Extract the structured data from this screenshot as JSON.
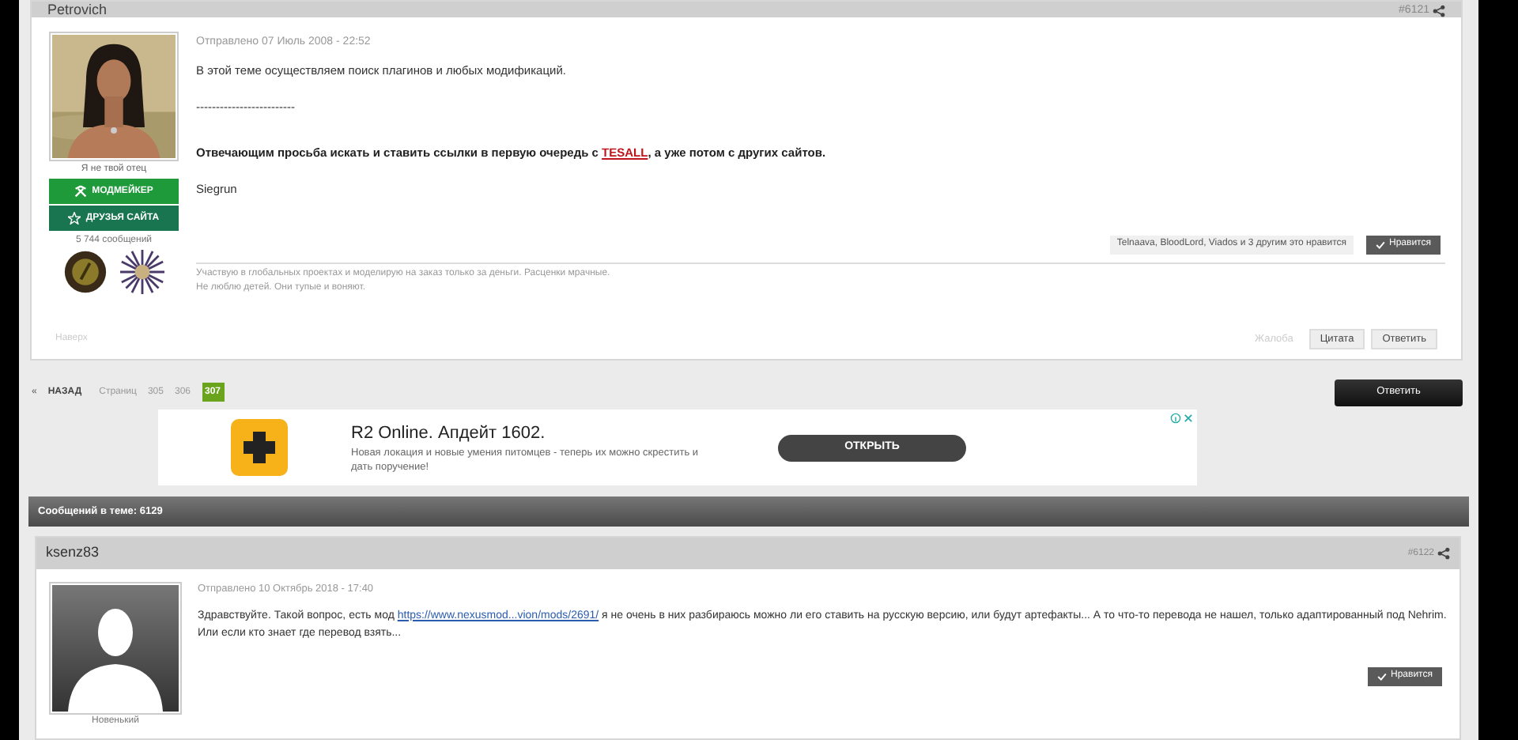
{
  "posts": [
    {
      "author": "Petrovich",
      "number": "#6121",
      "date": "Отправлено 07 Июль 2008 - 22:52",
      "user_title": "Я не твой отец",
      "badges": [
        {
          "label": "МОДМЕЙКЕР",
          "kind": "hammers",
          "color": "#1f9a3b"
        },
        {
          "label": "ДРУЗЬЯ САЙТА",
          "kind": "star",
          "color": "#18754f"
        }
      ],
      "post_count": "5 744 сообщений",
      "medals": true,
      "body": [
        {
          "kind": "text",
          "text": "В этой теме осуществляем поиск плагинов и любых модификаций."
        },
        {
          "kind": "text",
          "text": "-------------------------"
        },
        {
          "kind": "bold_link",
          "before": "Отвечающим просьба искать и ставить ссылки в первую очередь с ",
          "link": "TESALL",
          "after": ", а уже потом с других сайтов."
        },
        {
          "kind": "text",
          "text": "Siegrun"
        }
      ],
      "likes_text": "Telnaava, BloodLord, Viados и 3 другим это нравится",
      "like_button": "Нравится",
      "signature": [
        "Участвую в глобальных проектах и моделирую на заказ только за деньги. Расценки мрачные.",
        "Не люблю детей. Они тупые и воняют."
      ],
      "top_link": "Наверх",
      "actions": [
        {
          "label": "Жалоба",
          "disabled": true
        },
        {
          "label": "Цитата",
          "disabled": false
        },
        {
          "label": "Ответить",
          "disabled": false
        }
      ]
    }
  ],
  "pagination": {
    "prev": "«",
    "back": "НАЗАД",
    "label": "Страниц",
    "pages": [
      {
        "label": "305",
        "selected": false
      },
      {
        "label": "306",
        "selected": false
      },
      {
        "label": "307",
        "selected": true
      }
    ]
  },
  "reply_button": "Ответить",
  "ad": {
    "title": "R2 Online. Апдейт 1602.",
    "text": "Новая локация и новые умения питомцев - теперь их можно скрестить и дать поручение!",
    "button": "ОТКРЫТЬ"
  },
  "thread_bar": "Сообщений в теме: 6129",
  "post2": {
    "author": "ksenz83",
    "number": "#6122",
    "date": "Отправлено 10 Октябрь 2018 - 17:40",
    "user_title": "Новенький",
    "before": "Здравствуйте. Такой вопрос, есть мод ",
    "link": "https://www.nexusmod...vion/mods/2691/",
    "after": " я не очень в них разбираюсь можно ли его ставить на русскую версию, или будут артефакты... А то что-то перевода не нашел, только адаптированный под Nehrim. Или если кто знает где перевод взять...",
    "like_button": "Нравится"
  }
}
